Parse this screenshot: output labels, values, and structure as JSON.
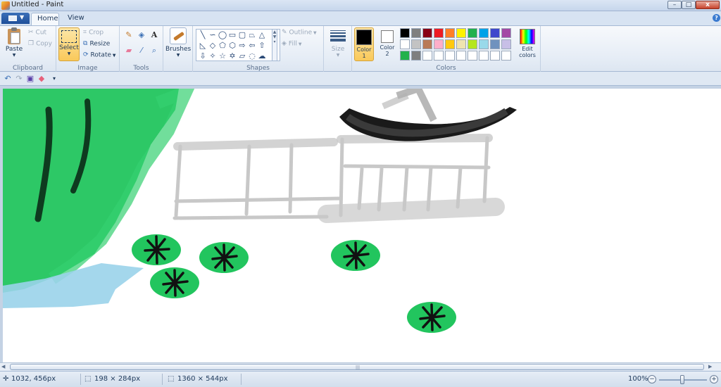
{
  "window": {
    "title": "Untitled - Paint",
    "minimize": "–",
    "maximize": "□",
    "close": "x"
  },
  "tabs": [
    {
      "label": "Home",
      "active": true
    },
    {
      "label": "View",
      "active": false
    }
  ],
  "help_label": "?",
  "ribbon": {
    "clipboard": {
      "label": "Clipboard",
      "paste": "Paste",
      "cut": "Cut",
      "copy": "Copy"
    },
    "image": {
      "label": "Image",
      "select": "Select",
      "crop": "Crop",
      "resize": "Resize",
      "rotate": "Rotate"
    },
    "tools": {
      "label": "Tools",
      "text_tool": "A"
    },
    "brushes": {
      "label": "Brushes"
    },
    "shapes": {
      "label": "Shapes",
      "outline": "Outline",
      "fill": "Fill"
    },
    "size": {
      "label": "Size"
    },
    "colors": {
      "label": "Colors",
      "color1": "Color 1",
      "color1_number": "1",
      "color2": "Color 2",
      "color2_number": "2",
      "edit_colors": "Edit colors",
      "color1_value": "#000000",
      "color2_value": "#ffffff",
      "palette_row1": [
        "#000000",
        "#7f7f7f",
        "#880015",
        "#ed1c24",
        "#ff7f27",
        "#fff200",
        "#22b14c",
        "#00a2e8",
        "#3f48cc",
        "#a349a4"
      ],
      "palette_row2": [
        "#ffffff",
        "#c3c3c3",
        "#b97a57",
        "#ffaec9",
        "#ffc90e",
        "#efe4b0",
        "#b5e61d",
        "#99d9ea",
        "#7092be",
        "#c8bfe7"
      ],
      "palette_row3": [
        "#22b14c",
        "#7f7f7f",
        "#ffffff",
        "#ffffff",
        "#ffffff",
        "#ffffff",
        "#ffffff",
        "#ffffff",
        "#ffffff",
        "#ffffff"
      ]
    }
  },
  "status": {
    "cursor_pos": "1032, 456px",
    "selection_size": "198 × 284px",
    "canvas_size": "1360 × 544px",
    "zoom": "100%",
    "zoom_out": "−",
    "zoom_in": "+"
  },
  "canvas_drawing": {
    "grass_color": "#22c55e",
    "water_color": "#9ad3ea",
    "boat_color": "#1a1a1a",
    "fence_color": "#c8c8c8",
    "flower_fill": "#22c55e",
    "flower_mark": "#111111"
  }
}
